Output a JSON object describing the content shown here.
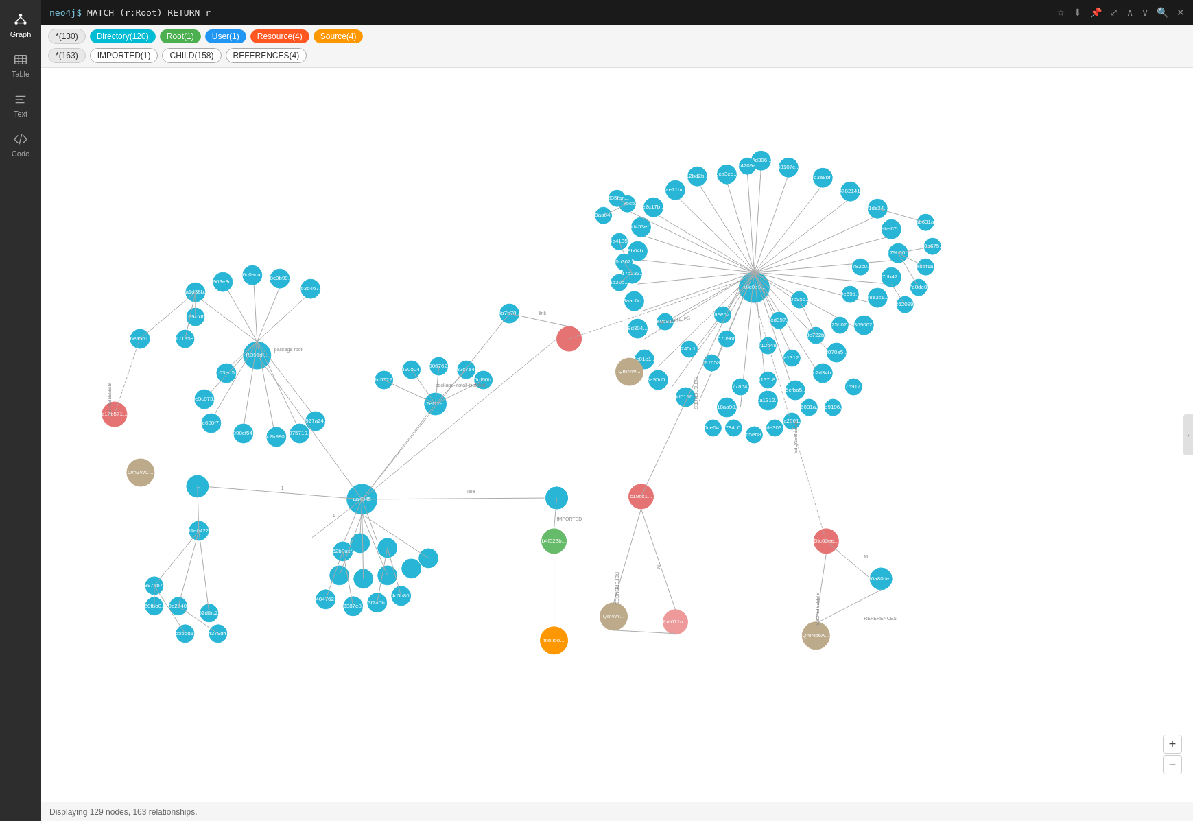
{
  "topbar": {
    "prompt": "neo4j$",
    "query": "MATCH (r:Root) RETURN r"
  },
  "sidebar": {
    "items": [
      {
        "id": "graph",
        "label": "Graph",
        "active": true
      },
      {
        "id": "table",
        "label": "Table",
        "active": false
      },
      {
        "id": "text",
        "label": "Text",
        "active": false
      },
      {
        "id": "code",
        "label": "Code",
        "active": false
      }
    ]
  },
  "filters": {
    "node_types": [
      {
        "label": "*(130)",
        "type": "asterisk"
      },
      {
        "label": "Directory(120)",
        "type": "directory"
      },
      {
        "label": "Root(1)",
        "type": "root"
      },
      {
        "label": "User(1)",
        "type": "user"
      },
      {
        "label": "Resource(4)",
        "type": "resource"
      },
      {
        "label": "Source(4)",
        "type": "source"
      }
    ],
    "relationship_types": [
      {
        "label": "*(163)",
        "type": "asterisk"
      },
      {
        "label": "IMPORTED(1)",
        "type": "imported"
      },
      {
        "label": "CHILD(158)",
        "type": "child"
      },
      {
        "label": "REFERENCES(4)",
        "type": "references"
      }
    ]
  },
  "statusbar": {
    "text": "Displaying 129 nodes, 163 relationships."
  },
  "zoom": {
    "in_label": "+",
    "out_label": "−"
  },
  "topbar_icons": [
    "☆",
    "⬇",
    "📌",
    "⤢",
    "∧",
    "∨",
    "🔍",
    "✕"
  ]
}
